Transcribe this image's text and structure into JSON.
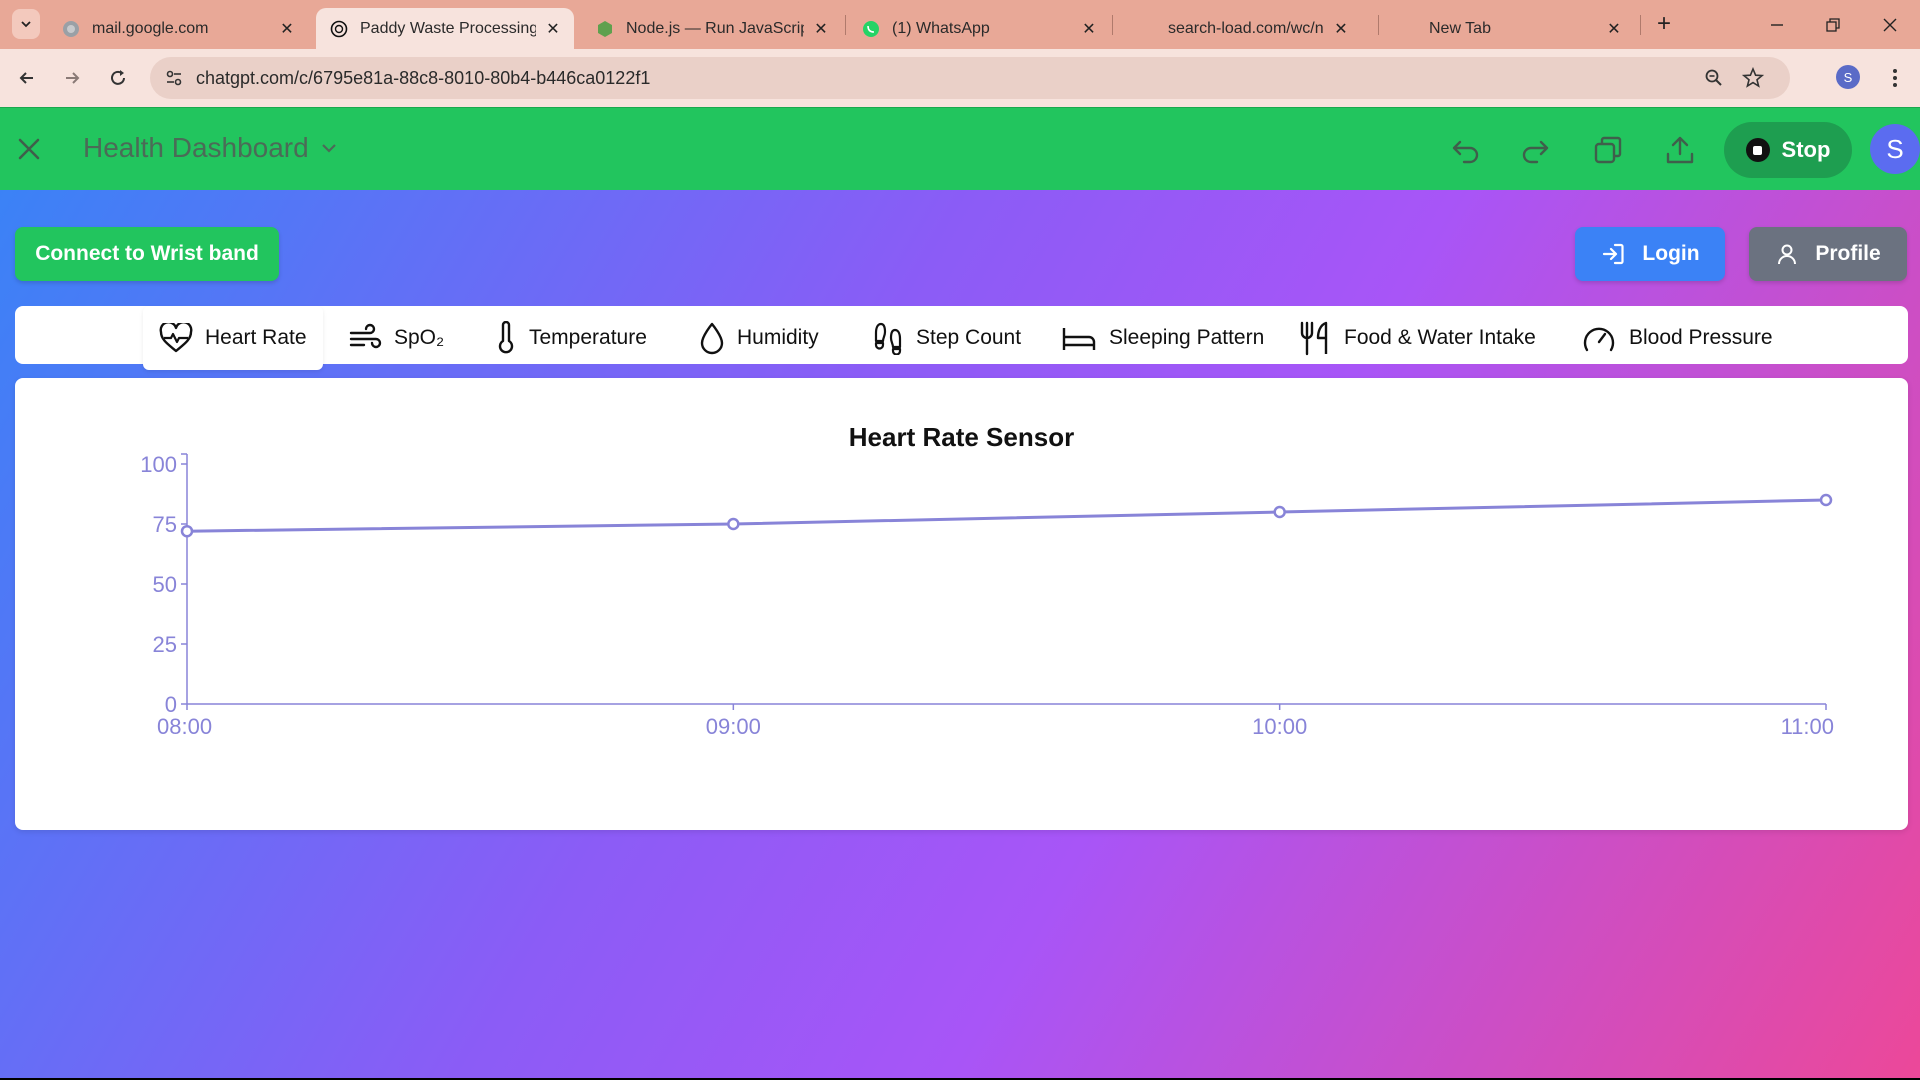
{
  "browser": {
    "tabs": [
      {
        "title": "mail.google.com",
        "icon": "globe-icon",
        "active": false
      },
      {
        "title": "Paddy Waste Processing M",
        "icon": "chatgpt-icon",
        "active": true
      },
      {
        "title": "Node.js — Run JavaScript E",
        "icon": "nodejs-icon",
        "active": false
      },
      {
        "title": "(1) WhatsApp",
        "icon": "whatsapp-icon",
        "active": false
      },
      {
        "title": "search-load.com/wc/newta",
        "icon": "",
        "active": false
      },
      {
        "title": "New Tab",
        "icon": "",
        "active": false
      }
    ],
    "url": "chatgpt.com/c/6795e81a-88c8-8010-80b4-b446ca0122f1",
    "profile_initial": "S"
  },
  "app": {
    "title": "Health Dashboard",
    "stop_label": "Stop",
    "avatar_initial": "S",
    "connect_label": "Connect to Wrist band",
    "login_label": "Login",
    "profile_label": "Profile",
    "sensor_tabs": [
      {
        "label": "Heart Rate",
        "icon": "heart-pulse-icon",
        "active": true
      },
      {
        "label": "SpO₂",
        "icon": "wind-icon",
        "active": false
      },
      {
        "label": "Temperature",
        "icon": "thermometer-icon",
        "active": false
      },
      {
        "label": "Humidity",
        "icon": "droplet-icon",
        "active": false
      },
      {
        "label": "Step Count",
        "icon": "footprints-icon",
        "active": false
      },
      {
        "label": "Sleeping Pattern",
        "icon": "bed-icon",
        "active": false
      },
      {
        "label": "Food & Water Intake",
        "icon": "utensils-icon",
        "active": false
      },
      {
        "label": "Blood Pressure",
        "icon": "gauge-icon",
        "active": false
      }
    ]
  },
  "colors": {
    "appbar": "#22c55e",
    "line": "#8884d8",
    "login": "#3b82f6",
    "profile": "#6b7280"
  },
  "chart_data": {
    "type": "line",
    "title": "Heart Rate Sensor",
    "categories": [
      "08:00",
      "09:00",
      "10:00",
      "11:00"
    ],
    "series": [
      {
        "values": [
          72,
          75,
          80,
          85
        ]
      }
    ],
    "yticks": [
      0,
      25,
      50,
      75,
      100
    ],
    "ylim": [
      0,
      100
    ],
    "grid": false,
    "legend": "none"
  }
}
